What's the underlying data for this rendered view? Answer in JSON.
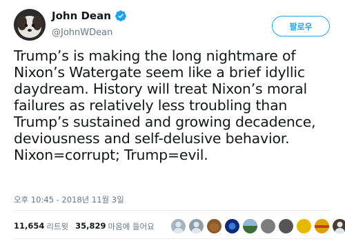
{
  "author": {
    "name": "John Dean",
    "handle": "@JohnWDean"
  },
  "follow_label": "팔로우",
  "tweet": {
    "text": "Trump’s is making the long nightmare of\nNixon’s Watergate seem like a brief idyllic\ndaydream. History will treat Nixon’s moral\nfailures as relatively less troubling than\nTrump’s sustained and growing decadence,\ndeviousness and self-delusive behavior.\nNixon=corrupt; Trump=evil.",
    "timestamp": "오후 10:45 - 2018년 11월 3일"
  },
  "stats": {
    "retweets_count": "11,654",
    "retweets_label": "리트윗",
    "likes_count": "35,829",
    "likes_label": "마음에 들어요"
  },
  "likers": [
    {
      "icon": "avatar-default-icon",
      "color": "#a6b4bd"
    },
    {
      "icon": "avatar-default-icon",
      "color": "#8e9ea8"
    },
    {
      "icon": "avatar-poop-emoji-icon",
      "color": "#8b5a2b"
    },
    {
      "icon": "avatar-blue-abstract-icon",
      "color": "#0d2b7a"
    },
    {
      "icon": "avatar-landscape-icon",
      "color": "#3c6e3a"
    },
    {
      "icon": "avatar-photo-icon",
      "color": "#7d7d7d"
    },
    {
      "icon": "avatar-photo-icon",
      "color": "#555555"
    },
    {
      "icon": "avatar-yellow-icon",
      "color": "#e6b800"
    },
    {
      "icon": "avatar-yellow-red-icon",
      "color": "#d9a400"
    },
    {
      "icon": "avatar-person-icon",
      "color": "#4a3b2f"
    }
  ],
  "colors": {
    "accent": "#1da1f2",
    "secondary_text": "#657786",
    "primary_text": "#14171a"
  }
}
